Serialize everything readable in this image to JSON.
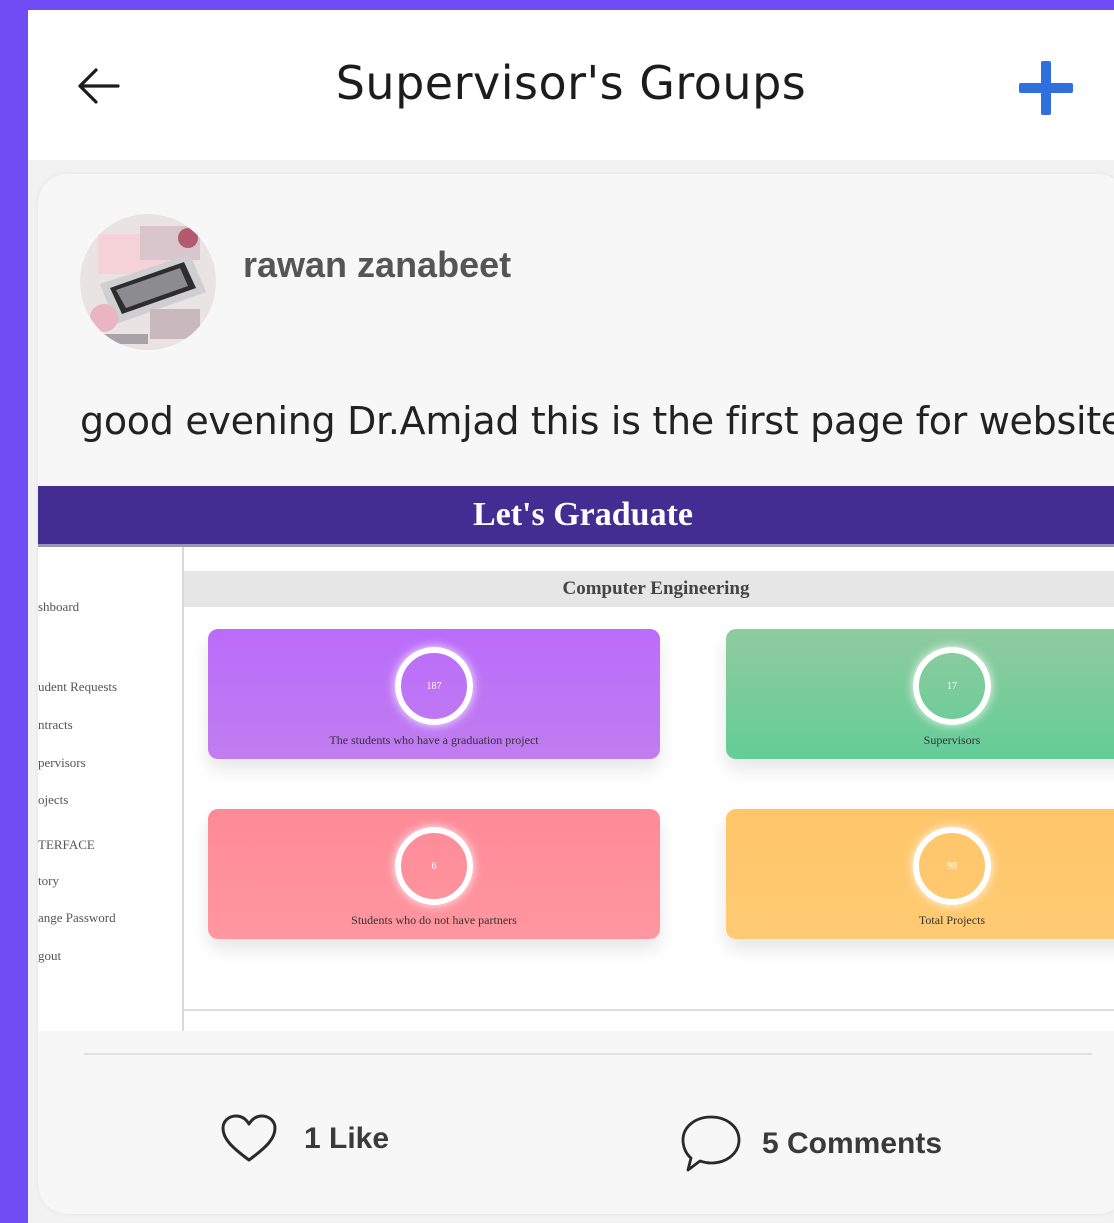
{
  "header": {
    "title": "Supervisor's Groups",
    "back_icon": "arrow-left-icon",
    "add_icon": "plus-icon",
    "accent": "#2f6fde"
  },
  "post": {
    "author": "rawan zanabeet",
    "text": "good evening Dr.Amjad this is the first page for website",
    "image": {
      "title": "Let's Graduate",
      "subtitle": "Computer Engineering",
      "sidebar_items": [
        "shboard",
        "udent Requests",
        "ntracts",
        "pervisors",
        "ojects",
        "TERFACE",
        "tory",
        "ange Password",
        "gout"
      ],
      "stats": [
        {
          "value": "187",
          "label": "The students who have a graduation project",
          "color": "#b66cf6"
        },
        {
          "value": "17",
          "label": "Supervisors",
          "color": "#7ccb9c"
        },
        {
          "value": "6",
          "label": "Students who do not have partners",
          "color": "#fd8f9a"
        },
        {
          "value": "98",
          "label": "Total Projects",
          "color": "#ffc86a"
        }
      ]
    },
    "likes_label": "1 Like",
    "comments_label": "5 Comments",
    "like_icon": "heart-outline-icon",
    "comment_icon": "speech-bubble-icon"
  }
}
